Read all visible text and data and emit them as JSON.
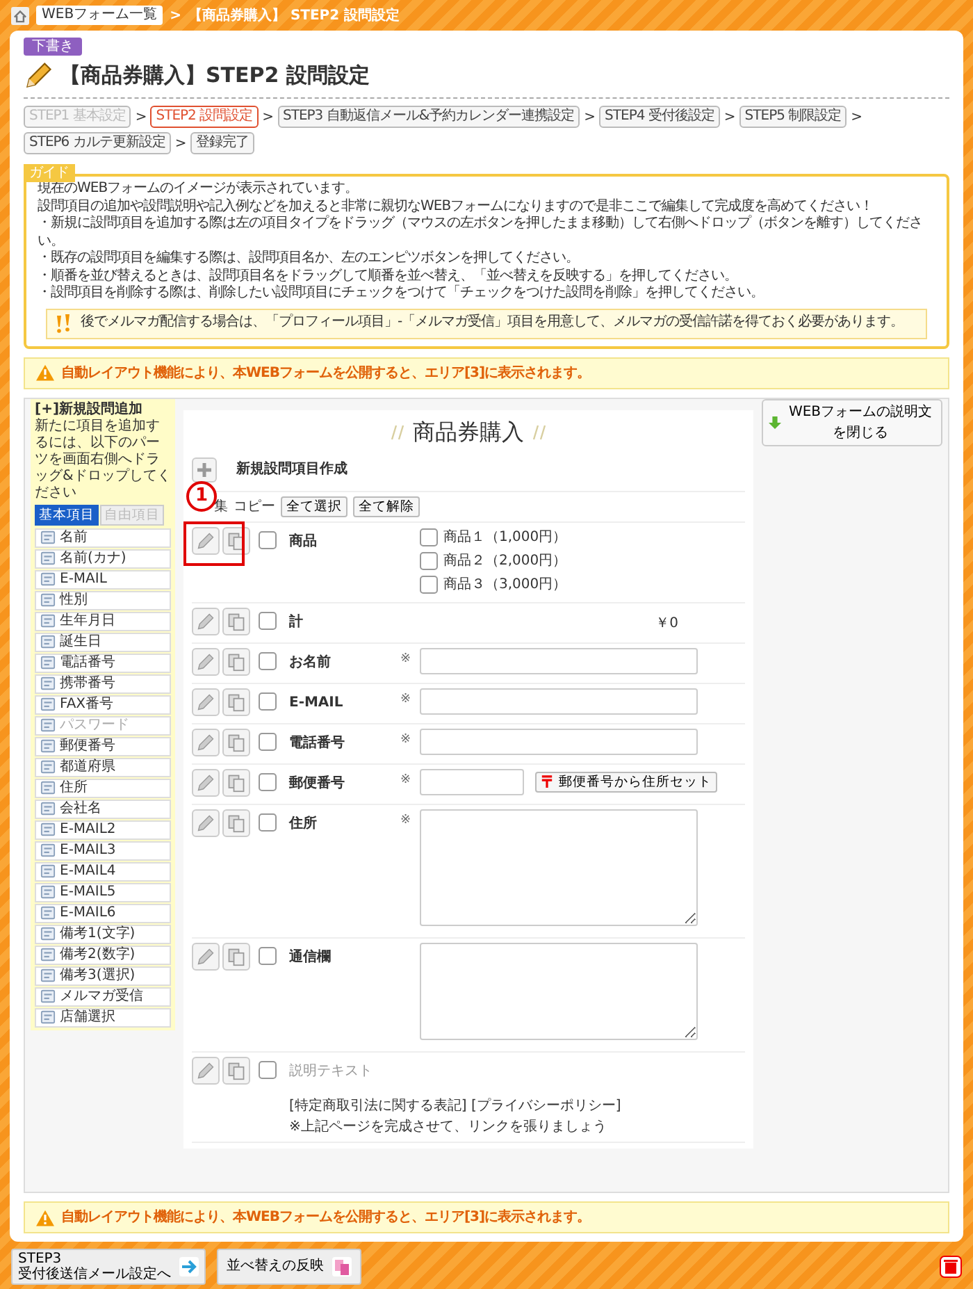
{
  "breadcrumb": {
    "items": [
      {
        "label": "WEBフォーム一覧",
        "kind": "link"
      },
      {
        "label": "【商品券購入】 STEP2 設問設定",
        "kind": "current"
      }
    ],
    "separator": ">"
  },
  "status_badge": "下書き",
  "page_title": "【商品券購入】STEP2 設問設定",
  "step_separator": ">",
  "steps": [
    {
      "label": "STEP1 基本設定",
      "selected": false,
      "disabled": true
    },
    {
      "label": "STEP2 設問設定",
      "selected": true,
      "disabled": false
    },
    {
      "label": "STEP3 自動返信メール&予約カレンダー連携設定",
      "selected": false,
      "disabled": false
    },
    {
      "label": "STEP4 受付後設定",
      "selected": false,
      "disabled": false
    },
    {
      "label": "STEP5 制限設定",
      "selected": false,
      "disabled": false
    },
    {
      "label": "STEP6 カルテ更新設定",
      "selected": false,
      "disabled": false
    },
    {
      "label": "登録完了",
      "selected": false,
      "disabled": false
    }
  ],
  "guide": {
    "label": "ガイド",
    "lines": [
      "現在のWEBフォームのイメージが表示されています。",
      "設問項目の追加や設問説明や記入例などを加えると非常に親切なWEBフォームになりますので是非ここで編集して完成度を高めてください！",
      "・新規に設問項目を追加する際は左の項目タイプをドラッグ（マウスの左ボタンを押したまま移動）して右側へドロップ（ボタンを離す）してください。",
      "・既存の設問項目を編集する際は、設問項目名か、左のエンピツボタンを押してください。",
      "・順番を並び替えるときは、設問項目名をドラッグして順番を並べ替え、「並べ替えを反映する」を押してください。",
      "・設問項目を削除する際は、削除したい設問項目にチェックをつけて「チェックをつけた設問を削除」を押してください。"
    ],
    "note": "後でメルマガ配信する場合は、「プロフィール項目」-「メルマガ受信」項目を用意して、メルマガの受信許諾を得ておく必要があります。"
  },
  "layout_notice": "自動レイアウト機能により、本WEBフォームを公開すると、エリア[3]に表示されます。",
  "palette": {
    "title": "[+]新規設問追加",
    "hint": "新たに項目を追加するには、以下のパーツを画面右側へドラッグ&ドロップしてください",
    "tabs": [
      {
        "label": "基本項目",
        "selected": true
      },
      {
        "label": "自由項目",
        "selected": false
      }
    ],
    "items": [
      {
        "label": "名前",
        "disabled": false
      },
      {
        "label": "名前(カナ)",
        "disabled": false
      },
      {
        "label": "E-MAIL",
        "disabled": false
      },
      {
        "label": "性別",
        "disabled": false
      },
      {
        "label": "生年月日",
        "disabled": false
      },
      {
        "label": "誕生日",
        "disabled": false
      },
      {
        "label": "電話番号",
        "disabled": false
      },
      {
        "label": "携帯番号",
        "disabled": false
      },
      {
        "label": "FAX番号",
        "disabled": false
      },
      {
        "label": "パスワード",
        "disabled": true
      },
      {
        "label": "郵便番号",
        "disabled": false
      },
      {
        "label": "都道府県",
        "disabled": false
      },
      {
        "label": "住所",
        "disabled": false
      },
      {
        "label": "会社名",
        "disabled": false
      },
      {
        "label": "E-MAIL2",
        "disabled": false
      },
      {
        "label": "E-MAIL3",
        "disabled": false
      },
      {
        "label": "E-MAIL4",
        "disabled": false
      },
      {
        "label": "E-MAIL5",
        "disabled": false
      },
      {
        "label": "E-MAIL6",
        "disabled": false
      },
      {
        "label": "備考1(文字)",
        "disabled": false
      },
      {
        "label": "備考2(数字)",
        "disabled": false
      },
      {
        "label": "備考3(選択)",
        "disabled": false
      },
      {
        "label": "メルマガ受信",
        "disabled": false
      },
      {
        "label": "店舗選択",
        "disabled": false
      }
    ]
  },
  "form": {
    "toggle_button": "WEBフォームの説明文を閉じる",
    "title": "商品券購入",
    "new_item": "新規設問項目作成",
    "header": {
      "edit": "集",
      "copy": "コピー",
      "buttons": [
        "全て選択",
        "全て解除"
      ]
    },
    "annotation": "1",
    "rows": [
      {
        "kind": "choices",
        "label": "商品",
        "required": false,
        "checked": false,
        "options": [
          {
            "label": "商品１（1,000円）",
            "checked": false
          },
          {
            "label": "商品２（2,000円）",
            "checked": false
          },
          {
            "label": "商品３（3,000円）",
            "checked": false
          }
        ]
      },
      {
        "kind": "total",
        "label": "計",
        "required": false,
        "checked": false,
        "value": "￥0"
      },
      {
        "kind": "text",
        "label": "お名前",
        "required": true,
        "checked": false
      },
      {
        "kind": "text",
        "label": "E-MAIL",
        "required": true,
        "checked": false
      },
      {
        "kind": "text",
        "label": "電話番号",
        "required": true,
        "checked": false
      },
      {
        "kind": "zip",
        "label": "郵便番号",
        "required": true,
        "checked": false,
        "button": "郵便番号から住所セット"
      },
      {
        "kind": "textarea",
        "label": "住所",
        "required": true,
        "checked": false
      },
      {
        "kind": "textarea",
        "label": "通信欄",
        "required": false,
        "checked": false
      },
      {
        "kind": "description",
        "label": "説明テキスト",
        "required": false,
        "checked": false,
        "lines": [
          "[特定商取引法に関する表記] [プライバシーポリシー]",
          "※上記ページを完成させて、リンクを張りましょう"
        ]
      }
    ],
    "required_mark": "※"
  },
  "layout_notice_bottom": "自動レイアウト機能により、本WEBフォームを公開すると、エリア[3]に表示されます。",
  "footer": {
    "buttons": [
      {
        "kind": "next",
        "label": "STEP3",
        "sublabel": "受付後送信メール設定へ"
      },
      {
        "kind": "sort",
        "label": "並べ替えの反映"
      }
    ]
  }
}
